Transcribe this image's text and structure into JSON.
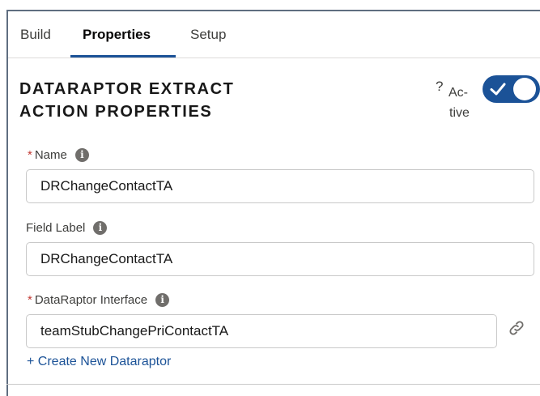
{
  "tabs": {
    "build": "Build",
    "properties": "Properties",
    "setup": "Setup"
  },
  "header": {
    "title_line1": "DATARAPTOR EXTRACT",
    "title_line2": "ACTION PROPERTIES",
    "help": "?",
    "active_line1": "Ac-",
    "active_line2": "tive",
    "active_on": true
  },
  "fields": {
    "name": {
      "required_mark": "*",
      "label": "Name",
      "value": "DRChangeContactTA"
    },
    "field_label": {
      "label": "Field Label",
      "value": "DRChangeContactTA"
    },
    "interface": {
      "required_mark": "*",
      "label": "DataRaptor Interface",
      "value": "teamStubChangePriContactTA"
    }
  },
  "create_link": "+ Create New Dataraptor",
  "icons": {
    "info": "i"
  },
  "colors": {
    "brand": "#1b5297",
    "required": "#c23934",
    "info_icon": "#706e6b"
  }
}
